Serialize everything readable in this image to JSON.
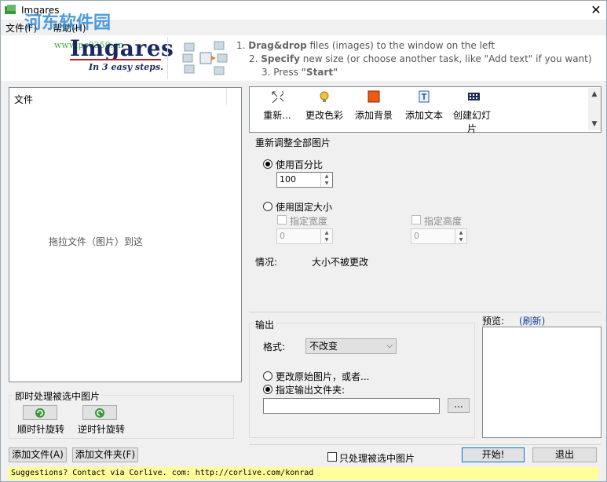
{
  "window": {
    "title": "Imgares",
    "close": "✕"
  },
  "menu": {
    "file": "文件(F)",
    "help": "帮助(H)"
  },
  "watermark": {
    "site": "河东软件园",
    "url": "www.pc0359.cn"
  },
  "logo": {
    "name": "Imgares",
    "tagline": "In 3 easy steps."
  },
  "steps": {
    "s1_num": "1.",
    "s1_bold": "Drag&drop",
    "s1_rest": " files (images)  to the window on the left",
    "s2_num": "2.",
    "s2_bold": "Specify",
    "s2_rest": " new size (or choose another task, like \"Add text\" if you want)",
    "s3_num": "3.",
    "s3_pre": " Press ",
    "s3_bold": "\"Start\""
  },
  "file_list": {
    "header": "文件",
    "hint": "拖拉文件（图片）到这"
  },
  "instant": {
    "label": "即时处理被选中图片",
    "rotate_cw": "顺时针旋转",
    "rotate_ccw": "逆时针旋转"
  },
  "tools": [
    {
      "label": "重新..."
    },
    {
      "label": "更改色彩"
    },
    {
      "label": "添加背景"
    },
    {
      "label": "添加文本"
    },
    {
      "label": "创建幻灯片"
    }
  ],
  "resize": {
    "title": "重新调整全部图片",
    "use_percent": "使用百分比",
    "percent_value": "100",
    "use_fixed": "使用固定大小",
    "width_label": "指定宽度",
    "height_label": "指定高度",
    "width_value": "0",
    "height_value": "0",
    "status_label": "情况:",
    "status_value": "大小不被更改"
  },
  "output": {
    "title": "输出",
    "format_label": "格式:",
    "format_value": "不改变",
    "change_original": "更改原始图片，或者...",
    "specify_folder": "指定输出文件夹:",
    "folder_value": "",
    "browse": "..."
  },
  "preview": {
    "label": "预览:",
    "refresh": "(刷新)"
  },
  "bottom": {
    "add_files": "添加文件(A)",
    "add_folder": "添加文件夹(F)",
    "only_selected": "只处理被选中图片",
    "start": "开始!",
    "exit": "退出"
  },
  "status": {
    "text": "Suggestions? Contact via Corlive. com: http://corlive.com/konrad"
  },
  "colors": {
    "accent": "#0078d7",
    "status_bg": "#ffff99",
    "logo": "#1b2a5c",
    "refresh": "#1a3f9c"
  }
}
